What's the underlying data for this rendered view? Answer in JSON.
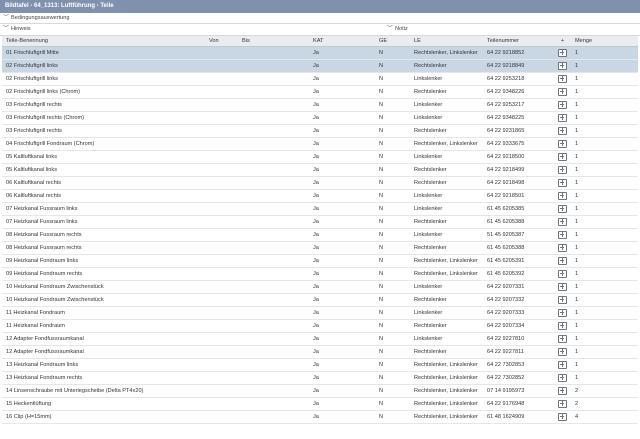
{
  "window": {
    "title": "Bildtafel - 64_1313: Luftführung - Teile"
  },
  "sections": {
    "bedingung": "Bedingungsauswertung",
    "hinweis": "Hinweis",
    "notiz": "Notiz"
  },
  "table": {
    "headers": [
      "Teile-Benennung",
      "Von",
      "Bis",
      "KAT",
      "GE",
      "LE",
      "Teilenummer",
      "+",
      "Menge"
    ],
    "rows": [
      {
        "name": "01 Frischluftgrill Mitte",
        "von": "",
        "bis": "",
        "kat": "Ja",
        "ge": "N",
        "le": "Rechtslenker, Linkslenker",
        "nr": "64 22 9218852",
        "menge": "1",
        "sel": true
      },
      {
        "name": "02 Frischluftgrill links",
        "von": "",
        "bis": "",
        "kat": "Ja",
        "ge": "N",
        "le": "Rechtslenker",
        "nr": "64 22 9218849",
        "menge": "1",
        "sel": true
      },
      {
        "name": "02 Frischluftgrill links",
        "von": "",
        "bis": "",
        "kat": "Ja",
        "ge": "N",
        "le": "Linkslenker",
        "nr": "64 22 9253218",
        "menge": "1",
        "sel": false
      },
      {
        "name": "02 Frischluftgrill links (Chrom)",
        "von": "",
        "bis": "",
        "kat": "Ja",
        "ge": "N",
        "le": "Rechtslenker",
        "nr": "64 22 9348226",
        "menge": "1",
        "sel": false
      },
      {
        "name": "03 Frischluftgrill rechts",
        "von": "",
        "bis": "",
        "kat": "Ja",
        "ge": "N",
        "le": "Linkslenker",
        "nr": "64 22 9253217",
        "menge": "1",
        "sel": false
      },
      {
        "name": "03 Frischluftgrill rechts (Chrom)",
        "von": "",
        "bis": "",
        "kat": "Ja",
        "ge": "N",
        "le": "Linkslenker",
        "nr": "64 22 9348225",
        "menge": "1",
        "sel": false
      },
      {
        "name": "03 Frischluftgrill rechts",
        "von": "",
        "bis": "",
        "kat": "Ja",
        "ge": "N",
        "le": "Rechtslenker",
        "nr": "64 22 9231865",
        "menge": "1",
        "sel": false
      },
      {
        "name": "04 Frischluftgrill Fondraum (Chrom)",
        "von": "",
        "bis": "",
        "kat": "Ja",
        "ge": "N",
        "le": "Rechtslenker, Linkslenker",
        "nr": "64 22 9333675",
        "menge": "1",
        "sel": false
      },
      {
        "name": "05 Kaltluftkanal links",
        "von": "",
        "bis": "",
        "kat": "Ja",
        "ge": "N",
        "le": "Linkslenker",
        "nr": "64 22 9218500",
        "menge": "1",
        "sel": false
      },
      {
        "name": "05 Kaltluftkanal links",
        "von": "",
        "bis": "",
        "kat": "Ja",
        "ge": "N",
        "le": "Rechtslenker",
        "nr": "64 22 9218499",
        "menge": "1",
        "sel": false
      },
      {
        "name": "06 Kaltluftkanal rechts",
        "von": "",
        "bis": "",
        "kat": "Ja",
        "ge": "N",
        "le": "Rechtslenker",
        "nr": "64 22 9218498",
        "menge": "1",
        "sel": false
      },
      {
        "name": "06 Kaltluftkanal rechts",
        "von": "",
        "bis": "",
        "kat": "Ja",
        "ge": "N",
        "le": "Linkslenker",
        "nr": "64 22 9218501",
        "menge": "1",
        "sel": false
      },
      {
        "name": "07 Heizkanal Fussraum links",
        "von": "",
        "bis": "",
        "kat": "Ja",
        "ge": "N",
        "le": "Linkslenker",
        "nr": "61 45 6205385",
        "menge": "1",
        "sel": false
      },
      {
        "name": "07 Heizkanal Fussraum links",
        "von": "",
        "bis": "",
        "kat": "Ja",
        "ge": "N",
        "le": "Rechtslenker",
        "nr": "61 45 6205388",
        "menge": "1",
        "sel": false
      },
      {
        "name": "08 Heizkanal Fussraum rechts",
        "von": "",
        "bis": "",
        "kat": "Ja",
        "ge": "N",
        "le": "Linkslenker",
        "nr": "51 45 9205387",
        "menge": "1",
        "sel": false
      },
      {
        "name": "08 Heizkanal Fussraum rechts",
        "von": "",
        "bis": "",
        "kat": "Ja",
        "ge": "N",
        "le": "Rechtslenker",
        "nr": "61 45 6205388",
        "menge": "1",
        "sel": false
      },
      {
        "name": "09 Heizkanal Fondraum links",
        "von": "",
        "bis": "",
        "kat": "Ja",
        "ge": "N",
        "le": "Rechtslenker, Linkslenker",
        "nr": "61 45 6205391",
        "menge": "1",
        "sel": false
      },
      {
        "name": "09 Heizkanal Fondraum rechts",
        "von": "",
        "bis": "",
        "kat": "Ja",
        "ge": "N",
        "le": "Rechtslenker, Linkslenker",
        "nr": "61 45 6205392",
        "menge": "1",
        "sel": false
      },
      {
        "name": "10 Heizkanal Fondraum Zwischenstück",
        "von": "",
        "bis": "",
        "kat": "Ja",
        "ge": "N",
        "le": "Linkslenker",
        "nr": "64 22 9207331",
        "menge": "1",
        "sel": false
      },
      {
        "name": "10 Heizkanal Fondraum Zwischenstück",
        "von": "",
        "bis": "",
        "kat": "Ja",
        "ge": "N",
        "le": "Rechtslenker",
        "nr": "64 22 9207332",
        "menge": "1",
        "sel": false
      },
      {
        "name": "11 Heizkanal Fondraum",
        "von": "",
        "bis": "",
        "kat": "Ja",
        "ge": "N",
        "le": "Linkslenker",
        "nr": "64 22 9207333",
        "menge": "1",
        "sel": false
      },
      {
        "name": "11 Heizkanal Fondraum",
        "von": "",
        "bis": "",
        "kat": "Ja",
        "ge": "N",
        "le": "Rechtslenker",
        "nr": "64 22 9207334",
        "menge": "1",
        "sel": false
      },
      {
        "name": "12 Adapter Fondfussraumkanal",
        "von": "",
        "bis": "",
        "kat": "Ja",
        "ge": "N",
        "le": "Linkslenker",
        "nr": "64 22 9227810",
        "menge": "1",
        "sel": false
      },
      {
        "name": "12 Adapter Fondfussraumkanal",
        "von": "",
        "bis": "",
        "kat": "Ja",
        "ge": "N",
        "le": "Rechtslenker",
        "nr": "64 22 9227811",
        "menge": "1",
        "sel": false
      },
      {
        "name": "13 Heizkanal Fondraum links",
        "von": "",
        "bis": "",
        "kat": "Ja",
        "ge": "N",
        "le": "Rechtslenker, Linkslenker",
        "nr": "64 22 7302853",
        "menge": "1",
        "sel": false
      },
      {
        "name": "13 Heizkanal Fondraum rechts",
        "von": "",
        "bis": "",
        "kat": "Ja",
        "ge": "N",
        "le": "Rechtslenker, Linkslenker",
        "nr": "64 22 7302852",
        "menge": "1",
        "sel": false
      },
      {
        "name": "14 Linsenschraube mit Unterlegscheibe (Delta PT4x20)",
        "von": "",
        "bis": "",
        "kat": "Ja",
        "ge": "N",
        "le": "Rechtslenker, Linkslenker",
        "nr": "07 14 9195973",
        "menge": "2",
        "sel": false
      },
      {
        "name": "15 Heckentlüftung",
        "von": "",
        "bis": "",
        "kat": "Ja",
        "ge": "N",
        "le": "Rechtslenker, Linkslenker",
        "nr": "64 22 9176948",
        "menge": "2",
        "sel": false
      },
      {
        "name": "16 Clip (H=15mm)",
        "von": "",
        "bis": "",
        "kat": "Ja",
        "ge": "N",
        "le": "Rechtslenker, Linkslenker",
        "nr": "61 48 1624909",
        "menge": "4",
        "sel": false
      }
    ]
  }
}
